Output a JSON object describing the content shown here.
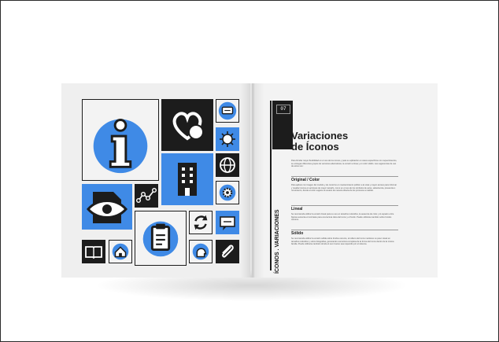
{
  "chapter_number": "07",
  "section_label": "ÍCONOS . VARIACIONES",
  "title_line1": "Variaciones",
  "title_line2": "de Íconos",
  "intro_text": "Para brindar mayor flexibilidad en el uso de los íconos y para su aplicación en casos específicos con requerimientos, se entregan diferentes grupos de versiones alternativas, la versión a línea y en color sólido. Las sugerencias de uso de estos son:",
  "sections": [
    {
      "heading": "Original / Color",
      "body": "Para aplicar con imagen del modulo y de contorno en mantenimiento público a la vista y mayor acceso para informar y resaltar iconos en acciones de mayor tamaño, como en el uso de los símbolos de aviso, advertencia, presencia o movimiento, donde el color sugiere el usuario de manera directa de los procesos a realizar."
    },
    {
      "heading": "Lineal",
      "body": "Se recomienda utilizar la versión lineal para su uso en tamaños reducidos, la ausencia de color y el espacio entre figuras aumenta el contraste para una lectura clara del ícono y el fondo. Puede utilizarse también sobre fondos oscuros."
    },
    {
      "heading": "Sólido",
      "body": "Se recomienda utilizar la versión sólida sobre fondos oscuros, el relleno del ícono mantiene su peso visual en tamaños reducidos y sobre fotografías, generando una lectura completa de la forma del ícono dentro de la misma familia. Puede utilizarse también donde el uso inverso sea requerido por el sistema."
    }
  ],
  "icons": [
    "info-icon",
    "heart-chat-icon",
    "message-icon",
    "virus-icon",
    "building-icon",
    "globe-icon",
    "gear-icon",
    "eye-icon",
    "graph-icon",
    "clipboard-icon",
    "sync-icon",
    "chat-icon",
    "book-icon",
    "home-icon",
    "head-icon",
    "paperclip-icon"
  ],
  "colors": {
    "accent": "#3f8ae6",
    "dark": "#1c1c1c",
    "page": "#f3f3f3"
  }
}
